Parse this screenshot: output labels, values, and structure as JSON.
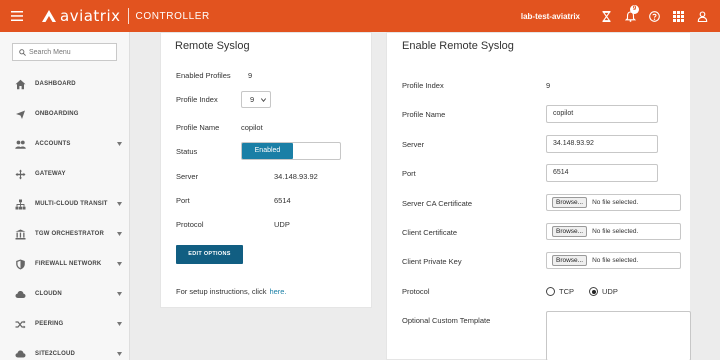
{
  "header": {
    "brand": "aviatrix",
    "product": "CONTROLLER",
    "account": "lab-test-aviatrix",
    "notification_count": "9",
    "icons": [
      "menu-icon",
      "hourglass-icon",
      "bell-icon",
      "help-icon",
      "apps-grid-icon",
      "user-icon"
    ]
  },
  "sidebar": {
    "search_placeholder": "Search Menu",
    "items": [
      {
        "label": "DASHBOARD",
        "icon": "home-icon",
        "expandable": false
      },
      {
        "label": "ONBOARDING",
        "icon": "airplane-icon",
        "expandable": false
      },
      {
        "label": "ACCOUNTS",
        "icon": "users-icon",
        "expandable": true
      },
      {
        "label": "GATEWAY",
        "icon": "gateway-icon",
        "expandable": false
      },
      {
        "label": "MULTI-CLOUD TRANSIT",
        "icon": "network-tree-icon",
        "expandable": true
      },
      {
        "label": "TGW ORCHESTRATOR",
        "icon": "building-icon",
        "expandable": true
      },
      {
        "label": "FIREWALL NETWORK",
        "icon": "shield-icon",
        "expandable": true
      },
      {
        "label": "CLOUDN",
        "icon": "cloud-icon",
        "expandable": true
      },
      {
        "label": "PEERING",
        "icon": "shuffle-icon",
        "expandable": true
      },
      {
        "label": "SITE2CLOUD",
        "icon": "site-cloud-icon",
        "expandable": true
      }
    ]
  },
  "remote_syslog": {
    "title": "Remote Syslog",
    "enabled_profiles_label": "Enabled Profiles",
    "enabled_profiles_value": "9",
    "profile_index_label": "Profile Index",
    "profile_index_value": "9",
    "profile_name_label": "Profile Name",
    "profile_name_value": "copilot",
    "status_label": "Status",
    "status_value": "Enabled",
    "server_label": "Server",
    "server_value": "34.148.93.92",
    "port_label": "Port",
    "port_value": "6514",
    "protocol_label": "Protocol",
    "protocol_value": "UDP",
    "edit_button": "EDIT OPTIONS",
    "setup_text": "For setup instructions, click",
    "setup_link": "here."
  },
  "enable_syslog": {
    "title": "Enable Remote Syslog",
    "profile_index_label": "Profile Index",
    "profile_index_value": "9",
    "profile_name_label": "Profile Name",
    "profile_name_value": "copilot",
    "server_label": "Server",
    "server_value": "34.148.93.92",
    "port_label": "Port",
    "port_value": "6514",
    "server_ca_label": "Server CA Certificate",
    "client_cert_label": "Client Certificate",
    "client_key_label": "Client Private Key",
    "browse_label": "Browse...",
    "no_file_text": "No file selected.",
    "protocol_label": "Protocol",
    "protocol_tcp": "TCP",
    "protocol_udp": "UDP",
    "protocol_selected": "UDP",
    "template_label": "Optional Custom Template"
  },
  "colors": {
    "header": "#e2531f",
    "primary_button": "#115e82",
    "toggle_enabled": "#1a7fa6",
    "link": "#1a7fa6"
  }
}
